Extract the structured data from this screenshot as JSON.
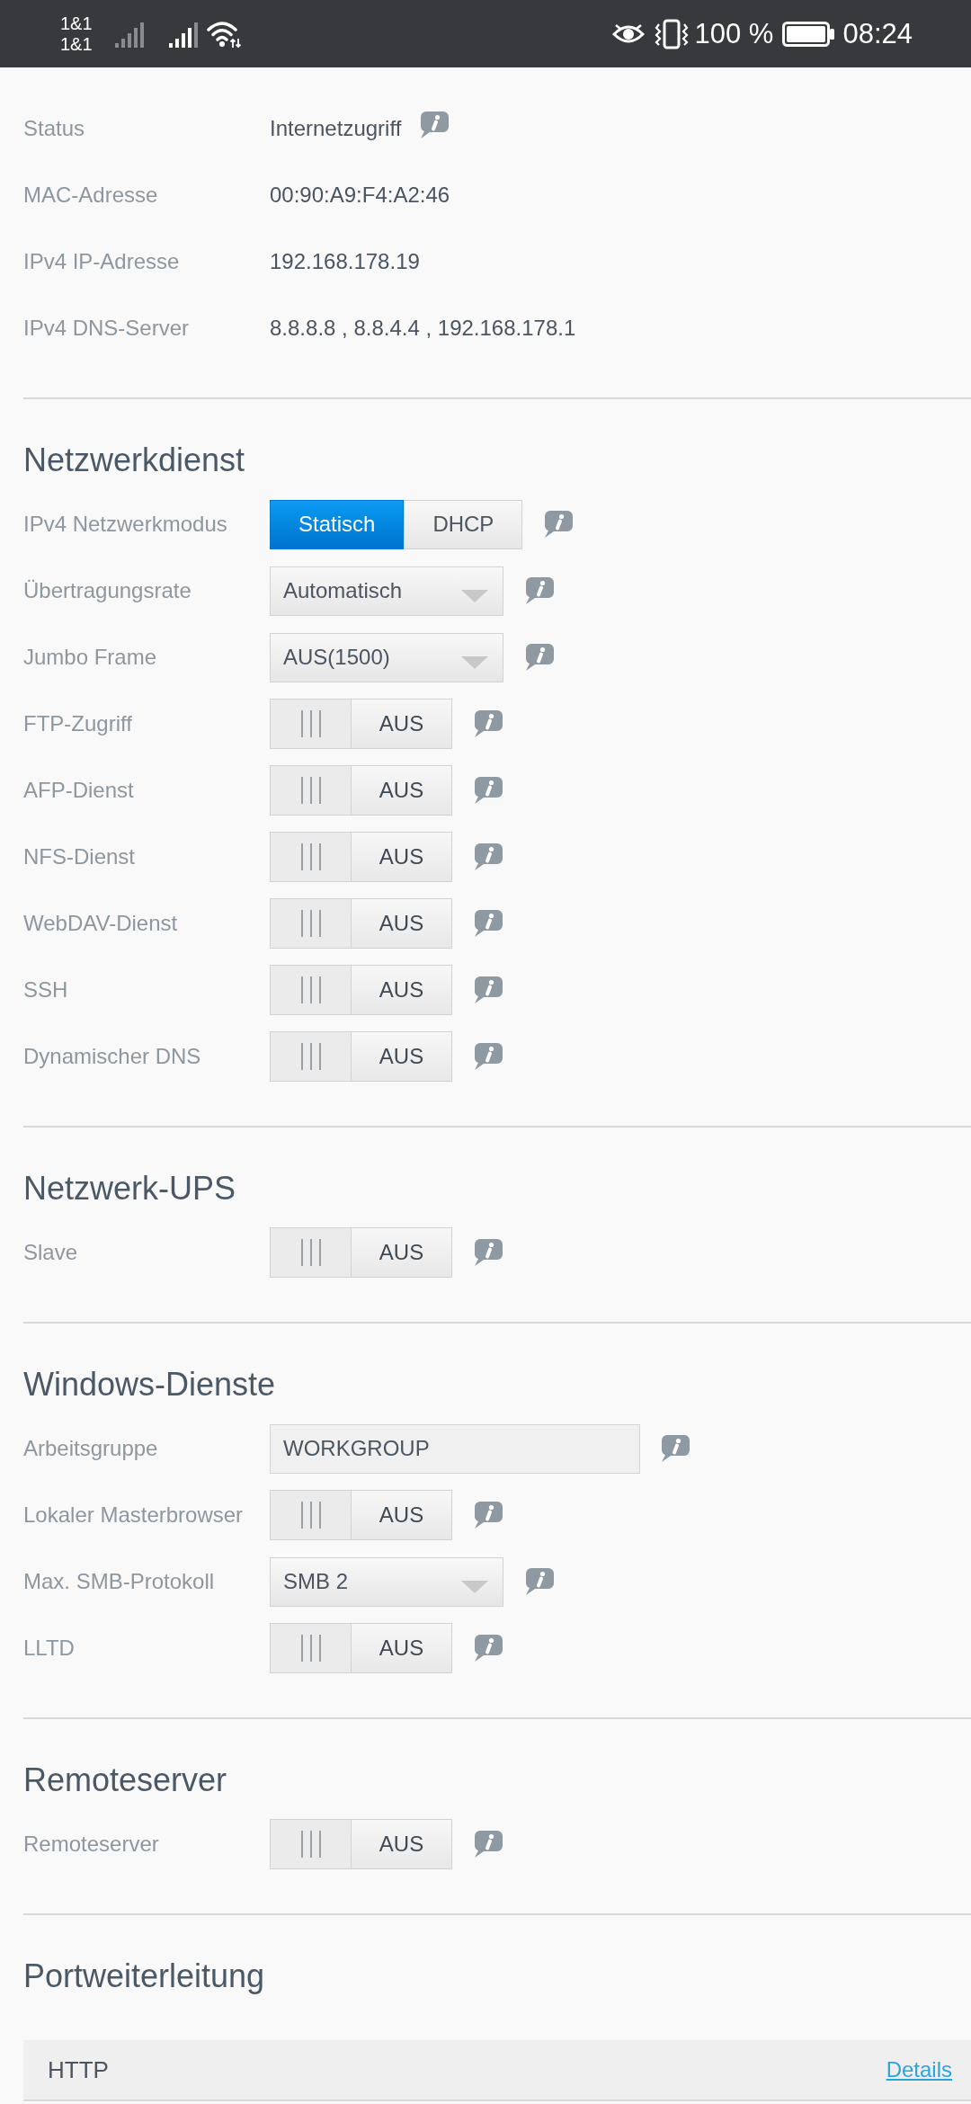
{
  "status_bar": {
    "carriers": [
      "1&1",
      "1&1"
    ],
    "battery": "100 %",
    "time": "08:24"
  },
  "sections": [
    {
      "rows": [
        {
          "kind": "text",
          "label": "Status",
          "value": "Internetzugriff",
          "info": true
        },
        {
          "kind": "text",
          "label": "MAC-Adresse",
          "value": "00:90:A9:F4:A2:46",
          "info": false
        },
        {
          "kind": "text",
          "label": "IPv4 IP-Adresse",
          "value": "192.168.178.19",
          "info": false
        },
        {
          "kind": "text",
          "label": "IPv4 DNS-Server",
          "value": "8.8.8.8 , 8.8.4.4 , 192.168.178.1",
          "info": false
        }
      ]
    },
    {
      "title": "Netzwerkdienst",
      "rows": [
        {
          "kind": "segmented",
          "label": "IPv4 Netzwerkmodus",
          "options": [
            {
              "label": "Statisch",
              "selected": true
            },
            {
              "label": "DHCP",
              "selected": false
            }
          ],
          "info": true
        },
        {
          "kind": "dropdown",
          "label": "Übertragungsrate",
          "value": "Automatisch",
          "info": true
        },
        {
          "kind": "dropdown",
          "label": "Jumbo Frame",
          "value": "AUS(1500)",
          "info": true
        },
        {
          "kind": "toggle",
          "label": "FTP-Zugriff",
          "on": false,
          "state_text": "AUS",
          "info": true
        },
        {
          "kind": "toggle",
          "label": "AFP-Dienst",
          "on": false,
          "state_text": "AUS",
          "info": true
        },
        {
          "kind": "toggle",
          "label": "NFS-Dienst",
          "on": false,
          "state_text": "AUS",
          "info": true
        },
        {
          "kind": "toggle",
          "label": "WebDAV-Dienst",
          "on": false,
          "state_text": "AUS",
          "info": true
        },
        {
          "kind": "toggle",
          "label": "SSH",
          "on": false,
          "state_text": "AUS",
          "info": true
        },
        {
          "kind": "toggle",
          "label": "Dynamischer DNS",
          "on": false,
          "state_text": "AUS",
          "info": true
        }
      ]
    },
    {
      "title": "Netzwerk-UPS",
      "rows": [
        {
          "kind": "toggle",
          "label": "Slave",
          "on": false,
          "state_text": "AUS",
          "info": true
        }
      ]
    },
    {
      "title": "Windows-Dienste",
      "rows": [
        {
          "kind": "field",
          "label": "Arbeitsgruppe",
          "value": "WORKGROUP",
          "info": true
        },
        {
          "kind": "toggle",
          "label": "Lokaler Masterbrowser",
          "on": false,
          "state_text": "AUS",
          "info": true
        },
        {
          "kind": "dropdown",
          "label": "Max. SMB-Protokoll",
          "value": "SMB 2",
          "info": true
        },
        {
          "kind": "toggle",
          "label": "LLTD",
          "on": false,
          "state_text": "AUS",
          "info": true
        }
      ]
    },
    {
      "title": "Remoteserver",
      "rows": [
        {
          "kind": "toggle",
          "label": "Remoteserver",
          "on": false,
          "state_text": "AUS",
          "info": true
        }
      ]
    },
    {
      "title": "Portweiterleitung",
      "rows": [
        {
          "kind": "port",
          "name": "HTTP",
          "link": "Details"
        }
      ]
    }
  ]
}
